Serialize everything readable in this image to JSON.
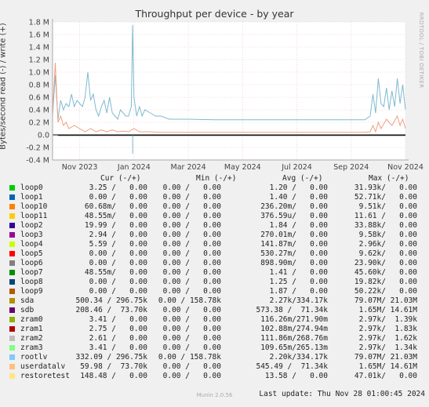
{
  "title": "Throughput per device - by year",
  "watermark": "RRDTOOL / TOBI OETIKER",
  "munin_version": "Munin 2.0.56",
  "last_update": "Last update: Thu Nov 28 01:00:45 2024",
  "legend_headers": {
    "cur": "Cur (-/+)",
    "min": "Min (-/+)",
    "avg": "Avg (-/+)",
    "max": "Max (-/+)"
  },
  "legend": [
    {
      "name": "loop0",
      "color": "#00cc00",
      "cur": "3.25 /   0.00",
      "min": "0.00 /   0.00",
      "avg": "1.20 /   0.00",
      "max": "31.93k/   0.00"
    },
    {
      "name": "loop1",
      "color": "#0066b3",
      "cur": "0.00 /   0.00",
      "min": "0.00 /   0.00",
      "avg": "1.40 /   0.00",
      "max": "52.71k/   0.00"
    },
    {
      "name": "loop10",
      "color": "#ff8000",
      "cur": "60.68m/   0.00",
      "min": "0.00 /   0.00",
      "avg": "236.20m/   0.00",
      "max": "9.51k/   0.00"
    },
    {
      "name": "loop11",
      "color": "#ffcc00",
      "cur": "48.55m/   0.00",
      "min": "0.00 /   0.00",
      "avg": "376.59u/   0.00",
      "max": "11.61 /   0.00"
    },
    {
      "name": "loop2",
      "color": "#330099",
      "cur": "19.99 /   0.00",
      "min": "0.00 /   0.00",
      "avg": "1.84 /   0.00",
      "max": "33.88k/   0.00"
    },
    {
      "name": "loop3",
      "color": "#990099",
      "cur": "2.94 /   0.00",
      "min": "0.00 /   0.00",
      "avg": "270.01m/   0.00",
      "max": "9.58k/   0.00"
    },
    {
      "name": "loop4",
      "color": "#ccff00",
      "cur": "5.59 /   0.00",
      "min": "0.00 /   0.00",
      "avg": "141.87m/   0.00",
      "max": "2.96k/   0.00"
    },
    {
      "name": "loop5",
      "color": "#ff0000",
      "cur": "0.00 /   0.00",
      "min": "0.00 /   0.00",
      "avg": "530.27m/   0.00",
      "max": "9.62k/   0.00"
    },
    {
      "name": "loop6",
      "color": "#808080",
      "cur": "0.00 /   0.00",
      "min": "0.00 /   0.00",
      "avg": "898.90m/   0.00",
      "max": "23.90k/   0.00"
    },
    {
      "name": "loop7",
      "color": "#008f00",
      "cur": "48.55m/   0.00",
      "min": "0.00 /   0.00",
      "avg": "1.41 /   0.00",
      "max": "45.60k/   0.00"
    },
    {
      "name": "loop8",
      "color": "#00487d",
      "cur": "0.00 /   0.00",
      "min": "0.00 /   0.00",
      "avg": "1.25 /   0.00",
      "max": "19.82k/   0.00"
    },
    {
      "name": "loop9",
      "color": "#b35a00",
      "cur": "0.00 /   0.00",
      "min": "0.00 /   0.00",
      "avg": "1.87 /   0.00",
      "max": "50.22k/   0.00"
    },
    {
      "name": "sda",
      "color": "#b38f00",
      "cur": "500.34 / 296.75k",
      "min": "0.00 / 158.78k",
      "avg": "2.27k/334.17k",
      "max": "79.07M/ 21.03M"
    },
    {
      "name": "sdb",
      "color": "#6b006b",
      "cur": "208.46 /  73.70k",
      "min": "0.00 /   0.00",
      "avg": "573.38 /  71.34k",
      "max": "1.65M/ 14.61M"
    },
    {
      "name": "zram0",
      "color": "#8fb300",
      "cur": "3.41 /   0.00",
      "min": "0.00 /   0.00",
      "avg": "116.26m/271.90m",
      "max": "2.97k/  1.39k"
    },
    {
      "name": "zram1",
      "color": "#b30000",
      "cur": "2.75 /   0.00",
      "min": "0.00 /   0.00",
      "avg": "102.88m/274.94m",
      "max": "2.97k/  1.83k"
    },
    {
      "name": "zram2",
      "color": "#bebebe",
      "cur": "2.61 /   0.00",
      "min": "0.00 /   0.00",
      "avg": "111.86m/268.76m",
      "max": "2.97k/  1.62k"
    },
    {
      "name": "zram3",
      "color": "#80ff80",
      "cur": "3.41 /   0.00",
      "min": "0.00 /   0.00",
      "avg": "109.65m/265.13m",
      "max": "2.97k/  1.34k"
    },
    {
      "name": "rootlv",
      "color": "#80c9ff",
      "cur": "332.09 / 296.75k",
      "min": "0.00 / 158.78k",
      "avg": "2.20k/334.17k",
      "max": "79.07M/ 21.03M"
    },
    {
      "name": "userdatalv",
      "color": "#ffc080",
      "cur": "59.98 /  73.70k",
      "min": "0.00 /   0.00",
      "avg": "545.49 /  71.34k",
      "max": "1.65M/ 14.61M"
    },
    {
      "name": "restoretest",
      "color": "#ffe680",
      "cur": "148.48 /   0.00",
      "min": "0.00 /   0.00",
      "avg": "13.58 /   0.00",
      "max": "47.01k/   0.00"
    }
  ],
  "chart_data": {
    "type": "line",
    "title": "Throughput per device - by year",
    "ylabel": "Bytes/second read (-) / write (+)",
    "ylim": [
      -0.4,
      1.8
    ],
    "y_unit": "M",
    "y_ticks": [
      {
        "v": 1.8,
        "label": "1.8 M"
      },
      {
        "v": 1.6,
        "label": "1.6 M"
      },
      {
        "v": 1.4,
        "label": "1.4 M"
      },
      {
        "v": 1.2,
        "label": "1.2 M"
      },
      {
        "v": 1.0,
        "label": "1.0 M"
      },
      {
        "v": 0.8,
        "label": "0.8 M"
      },
      {
        "v": 0.6,
        "label": "0.6 M"
      },
      {
        "v": 0.4,
        "label": "0.4 M"
      },
      {
        "v": 0.2,
        "label": "0.2 M"
      },
      {
        "v": 0.0,
        "label": "0.0"
      },
      {
        "v": -0.2,
        "label": "-0.2 M"
      },
      {
        "v": -0.4,
        "label": "-0.4 M"
      }
    ],
    "xlim": [
      0,
      13
    ],
    "x_ticks": [
      {
        "v": 1,
        "label": "Nov 2023"
      },
      {
        "v": 3,
        "label": "Jan 2024"
      },
      {
        "v": 5,
        "label": "Mar 2024"
      },
      {
        "v": 7,
        "label": "May 2024"
      },
      {
        "v": 9,
        "label": "Jul 2024"
      },
      {
        "v": 11,
        "label": "Sep 2024"
      },
      {
        "v": 13,
        "label": "Nov 2024"
      }
    ],
    "series": [
      {
        "name": "rootlv",
        "color": "#7fb9cf",
        "points": [
          [
            0.0,
            0.3
          ],
          [
            0.1,
            0.95
          ],
          [
            0.2,
            0.25
          ],
          [
            0.3,
            0.55
          ],
          [
            0.4,
            0.4
          ],
          [
            0.5,
            0.5
          ],
          [
            0.6,
            0.45
          ],
          [
            0.7,
            0.65
          ],
          [
            0.8,
            0.45
          ],
          [
            0.9,
            0.55
          ],
          [
            1.0,
            0.5
          ],
          [
            1.1,
            0.45
          ],
          [
            1.2,
            0.6
          ],
          [
            1.3,
            1.0
          ],
          [
            1.4,
            0.55
          ],
          [
            1.5,
            0.65
          ],
          [
            1.6,
            0.4
          ],
          [
            1.7,
            0.3
          ],
          [
            1.8,
            0.45
          ],
          [
            1.9,
            0.55
          ],
          [
            2.0,
            0.35
          ],
          [
            2.1,
            0.6
          ],
          [
            2.2,
            0.35
          ],
          [
            2.3,
            0.3
          ],
          [
            2.4,
            0.25
          ],
          [
            2.5,
            0.4
          ],
          [
            2.6,
            0.35
          ],
          [
            2.7,
            0.3
          ],
          [
            2.8,
            0.3
          ],
          [
            2.9,
            0.45
          ],
          [
            2.95,
            1.75
          ],
          [
            3.0,
            0.6
          ],
          [
            3.1,
            0.3
          ],
          [
            3.2,
            0.45
          ],
          [
            3.3,
            0.3
          ],
          [
            3.4,
            0.4
          ],
          [
            3.6,
            0.35
          ],
          [
            3.8,
            0.3
          ],
          [
            4.0,
            0.3
          ],
          [
            4.3,
            0.25
          ],
          [
            5.0,
            0.25
          ],
          [
            6.0,
            0.24
          ],
          [
            7.0,
            0.24
          ],
          [
            8.0,
            0.24
          ],
          [
            9.0,
            0.24
          ],
          [
            10.0,
            0.24
          ],
          [
            11.0,
            0.24
          ],
          [
            11.5,
            0.24
          ],
          [
            11.7,
            0.3
          ],
          [
            11.8,
            0.65
          ],
          [
            11.9,
            0.35
          ],
          [
            12.0,
            0.9
          ],
          [
            12.1,
            0.5
          ],
          [
            12.2,
            0.45
          ],
          [
            12.3,
            0.75
          ],
          [
            12.4,
            0.4
          ],
          [
            12.5,
            0.7
          ],
          [
            12.6,
            0.45
          ],
          [
            12.7,
            0.9
          ],
          [
            12.8,
            0.5
          ],
          [
            12.9,
            0.8
          ],
          [
            13.0,
            0.4
          ]
        ]
      },
      {
        "name": "userdatalv",
        "color": "#f0a080",
        "points": [
          [
            0.0,
            0.35
          ],
          [
            0.1,
            1.15
          ],
          [
            0.2,
            0.2
          ],
          [
            0.3,
            0.3
          ],
          [
            0.4,
            0.15
          ],
          [
            0.5,
            0.2
          ],
          [
            0.6,
            0.1
          ],
          [
            0.8,
            0.15
          ],
          [
            1.0,
            0.1
          ],
          [
            1.2,
            0.05
          ],
          [
            1.4,
            0.1
          ],
          [
            1.6,
            0.05
          ],
          [
            1.8,
            0.08
          ],
          [
            2.0,
            0.05
          ],
          [
            2.2,
            0.08
          ],
          [
            2.4,
            0.05
          ],
          [
            2.6,
            0.06
          ],
          [
            2.8,
            0.05
          ],
          [
            3.0,
            0.1
          ],
          [
            3.2,
            0.05
          ],
          [
            3.5,
            0.05
          ],
          [
            4.0,
            0.04
          ],
          [
            5.0,
            0.04
          ],
          [
            6.0,
            0.04
          ],
          [
            7.0,
            0.04
          ],
          [
            8.0,
            0.04
          ],
          [
            9.0,
            0.04
          ],
          [
            10.0,
            0.04
          ],
          [
            11.0,
            0.04
          ],
          [
            11.5,
            0.04
          ],
          [
            11.7,
            0.05
          ],
          [
            11.8,
            0.15
          ],
          [
            11.9,
            0.05
          ],
          [
            12.0,
            0.2
          ],
          [
            12.1,
            0.1
          ],
          [
            12.3,
            0.25
          ],
          [
            12.5,
            0.15
          ],
          [
            12.7,
            0.3
          ],
          [
            12.8,
            0.15
          ],
          [
            12.9,
            0.25
          ],
          [
            13.0,
            0.1
          ]
        ]
      },
      {
        "name": "sda",
        "color": "#333333",
        "points": [
          [
            0.2,
            -0.01
          ],
          [
            13.0,
            -0.01
          ]
        ]
      }
    ]
  }
}
